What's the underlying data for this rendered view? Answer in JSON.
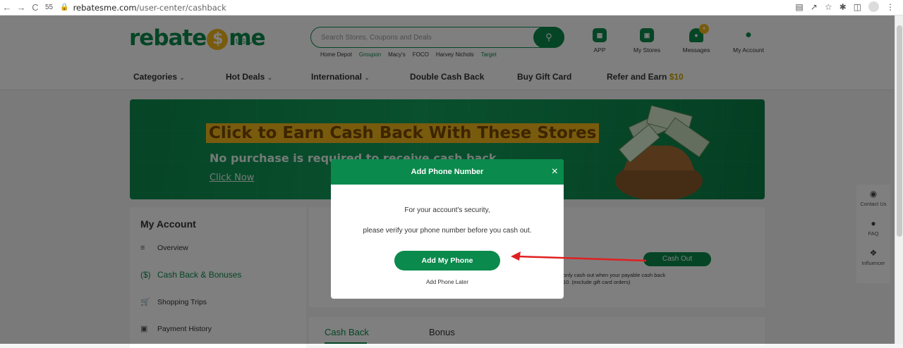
{
  "browser": {
    "back_icon": "←",
    "forward_icon": "→",
    "reload_icon": "C",
    "tab_count": "55",
    "url_host": "rebatesme.com",
    "url_path": "/user-center/cashback"
  },
  "header": {
    "logo_left": "rebate",
    "logo_coin": "$",
    "logo_right": "me",
    "region": "US",
    "search_placeholder": "Search Stores, Coupons and Deals",
    "quick_links": [
      {
        "label": "Home Depot",
        "color": "#333333"
      },
      {
        "label": "Groupon",
        "color": "#0a8a4c"
      },
      {
        "label": "Macy's",
        "color": "#333333"
      },
      {
        "label": "FOCO",
        "color": "#333333"
      },
      {
        "label": "Harvey Nichols",
        "color": "#333333"
      },
      {
        "label": "Target",
        "color": "#0a8a4c"
      }
    ],
    "icons": [
      {
        "label": "APP",
        "icon": "app-icon"
      },
      {
        "label": "My Stores",
        "icon": "store-icon"
      },
      {
        "label": "Messages",
        "icon": "bell-icon"
      },
      {
        "label": "My Account",
        "icon": "user-icon"
      }
    ]
  },
  "nav": {
    "categories": "Categories",
    "hot_deals": "Hot Deals",
    "international": "International",
    "double_cash_back": "Double Cash Back",
    "buy_gift_card": "Buy Gift Card",
    "refer_prefix": "Refer and Earn ",
    "refer_amount": "$10"
  },
  "banner": {
    "headline": "Click to Earn Cash Back With These Stores",
    "subline": "No purchase is required to receive cash back",
    "cta": "Click Now"
  },
  "account": {
    "title": "My Account",
    "menu": [
      {
        "label": "Overview",
        "icon": "list-icon"
      },
      {
        "label": "Cash Back & Bonuses",
        "icon": "dollar-circle-icon"
      },
      {
        "label": "Shopping Trips",
        "icon": "cart-icon"
      },
      {
        "label": "Payment History",
        "icon": "card-icon"
      }
    ]
  },
  "cashback_panel": {
    "cash_out_label": "Cash Out",
    "note_line1": "only cash out when your payable cash back",
    "note_line2": "10. (exclude gift card orders)",
    "tab_cash_back": "Cash Back",
    "tab_bonus": "Bonus"
  },
  "side_tools": [
    {
      "label": "Contact Us",
      "icon": "headset-icon"
    },
    {
      "label": "FAQ",
      "icon": "question-icon"
    },
    {
      "label": "Influencer",
      "icon": "handshake-icon"
    }
  ],
  "modal": {
    "title": "Add Phone Number",
    "close": "×",
    "line1": "For your account's security,",
    "line2": "please verify your phone number before you cash out.",
    "primary_button": "Add My Phone",
    "secondary_link": "Add Phone Later"
  },
  "colors": {
    "brand_green": "#0a8a4c",
    "accent_gold": "#f2b61c",
    "arrow_red": "#e02020"
  }
}
